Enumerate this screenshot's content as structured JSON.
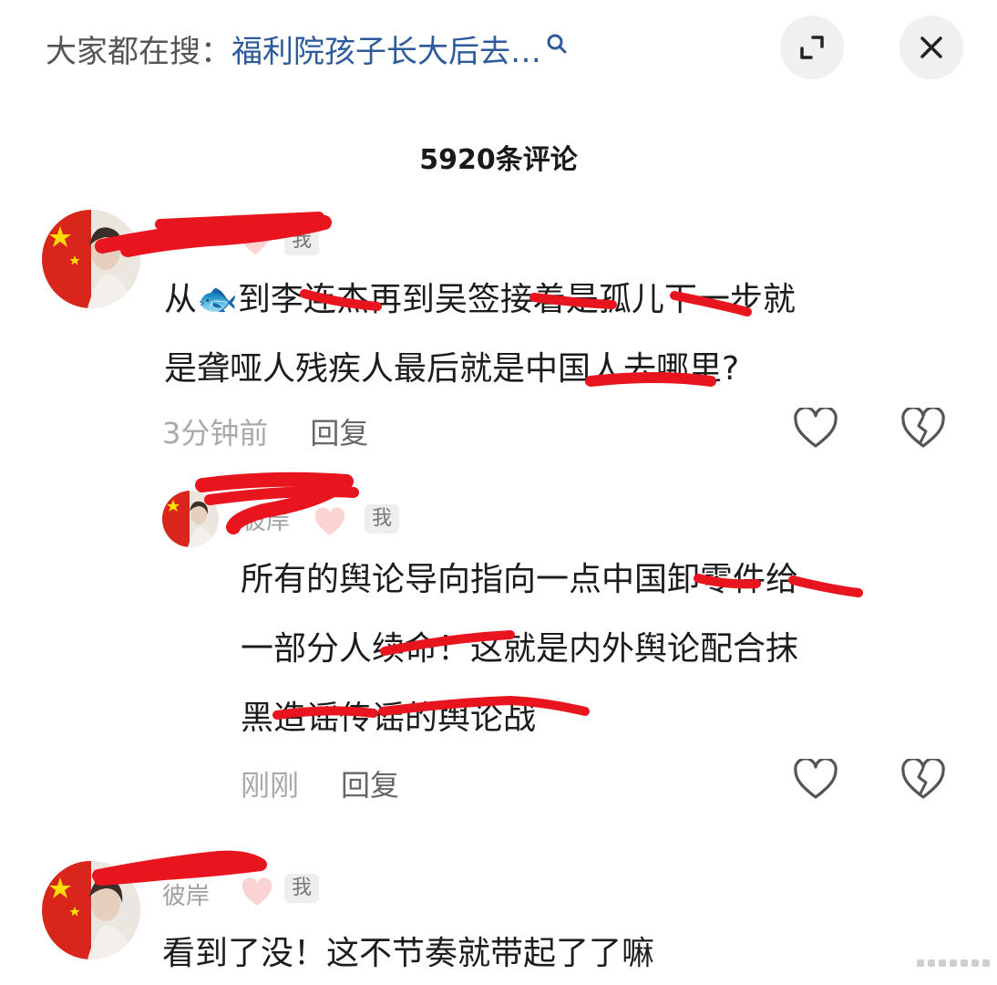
{
  "header": {
    "search_prefix": "大家都在搜：",
    "search_query": "福利院孩子长大后去…",
    "expand_icon": "expand-icon",
    "close_icon": "close-icon"
  },
  "comment_count": "5920条评论",
  "comments": [
    {
      "username": "",
      "badge": "我",
      "line1": "从🐟到李连杰再到吴签接着是孤儿下一步就",
      "line2": "是聋哑人残疾人最后就是中国人去哪里?",
      "time": "3分钟前",
      "reply_label": "回复"
    },
    {
      "username": "彼岸",
      "badge": "我",
      "line1": "所有的舆论导向指向一点中国卸零件给",
      "line2": "一部分人续命！这就是内外舆论配合抹",
      "line3": "黑造谣传谣的舆论战",
      "time": "刚刚",
      "reply_label": "回复"
    },
    {
      "username": "彼岸",
      "badge": "我",
      "line1": "看到了没！这不节奏就带起了了嘛"
    }
  ],
  "colors": {
    "link": "#2d5a9b",
    "redaction": "#e8141e",
    "flag_red": "#d9261c",
    "flag_star": "#ffde00"
  }
}
